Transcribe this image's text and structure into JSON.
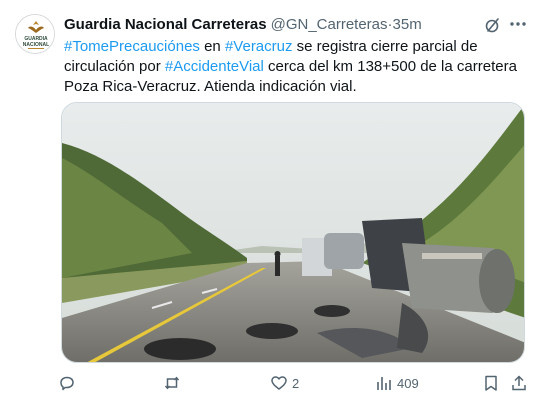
{
  "tweet": {
    "display_name": "Guardia Nacional Carreteras",
    "handle": "@GN_Carreteras",
    "separator": " · ",
    "time": "35m",
    "avatar_lines": [
      "GUARDIA",
      "NACIONAL"
    ],
    "text_segments": [
      {
        "text": "#TomePrecauciónes",
        "type": "hashtag"
      },
      {
        "text": " en ",
        "type": "plain"
      },
      {
        "text": "#Veracruz",
        "type": "hashtag"
      },
      {
        "text": " se registra cierre parcial de circulación por ",
        "type": "plain"
      },
      {
        "text": "#AccidenteVial",
        "type": "hashtag"
      },
      {
        "text": " cerca del km 138+500 de la carretera Poza Rica-Veracruz. Atienda indicación vial.",
        "type": "plain"
      }
    ]
  },
  "actions": {
    "reply_count": "",
    "retweet_count": "",
    "like_count": "2",
    "views_count": "409"
  },
  "icons": {
    "grok": "grok-icon",
    "more": "more-icon",
    "reply": "reply-icon",
    "retweet": "retweet-icon",
    "like": "heart-icon",
    "views": "views-icon",
    "bookmark": "bookmark-icon",
    "share": "share-icon"
  },
  "colors": {
    "hashtag": "#1d9bf0",
    "muted": "#536471",
    "text": "#0f1419"
  }
}
